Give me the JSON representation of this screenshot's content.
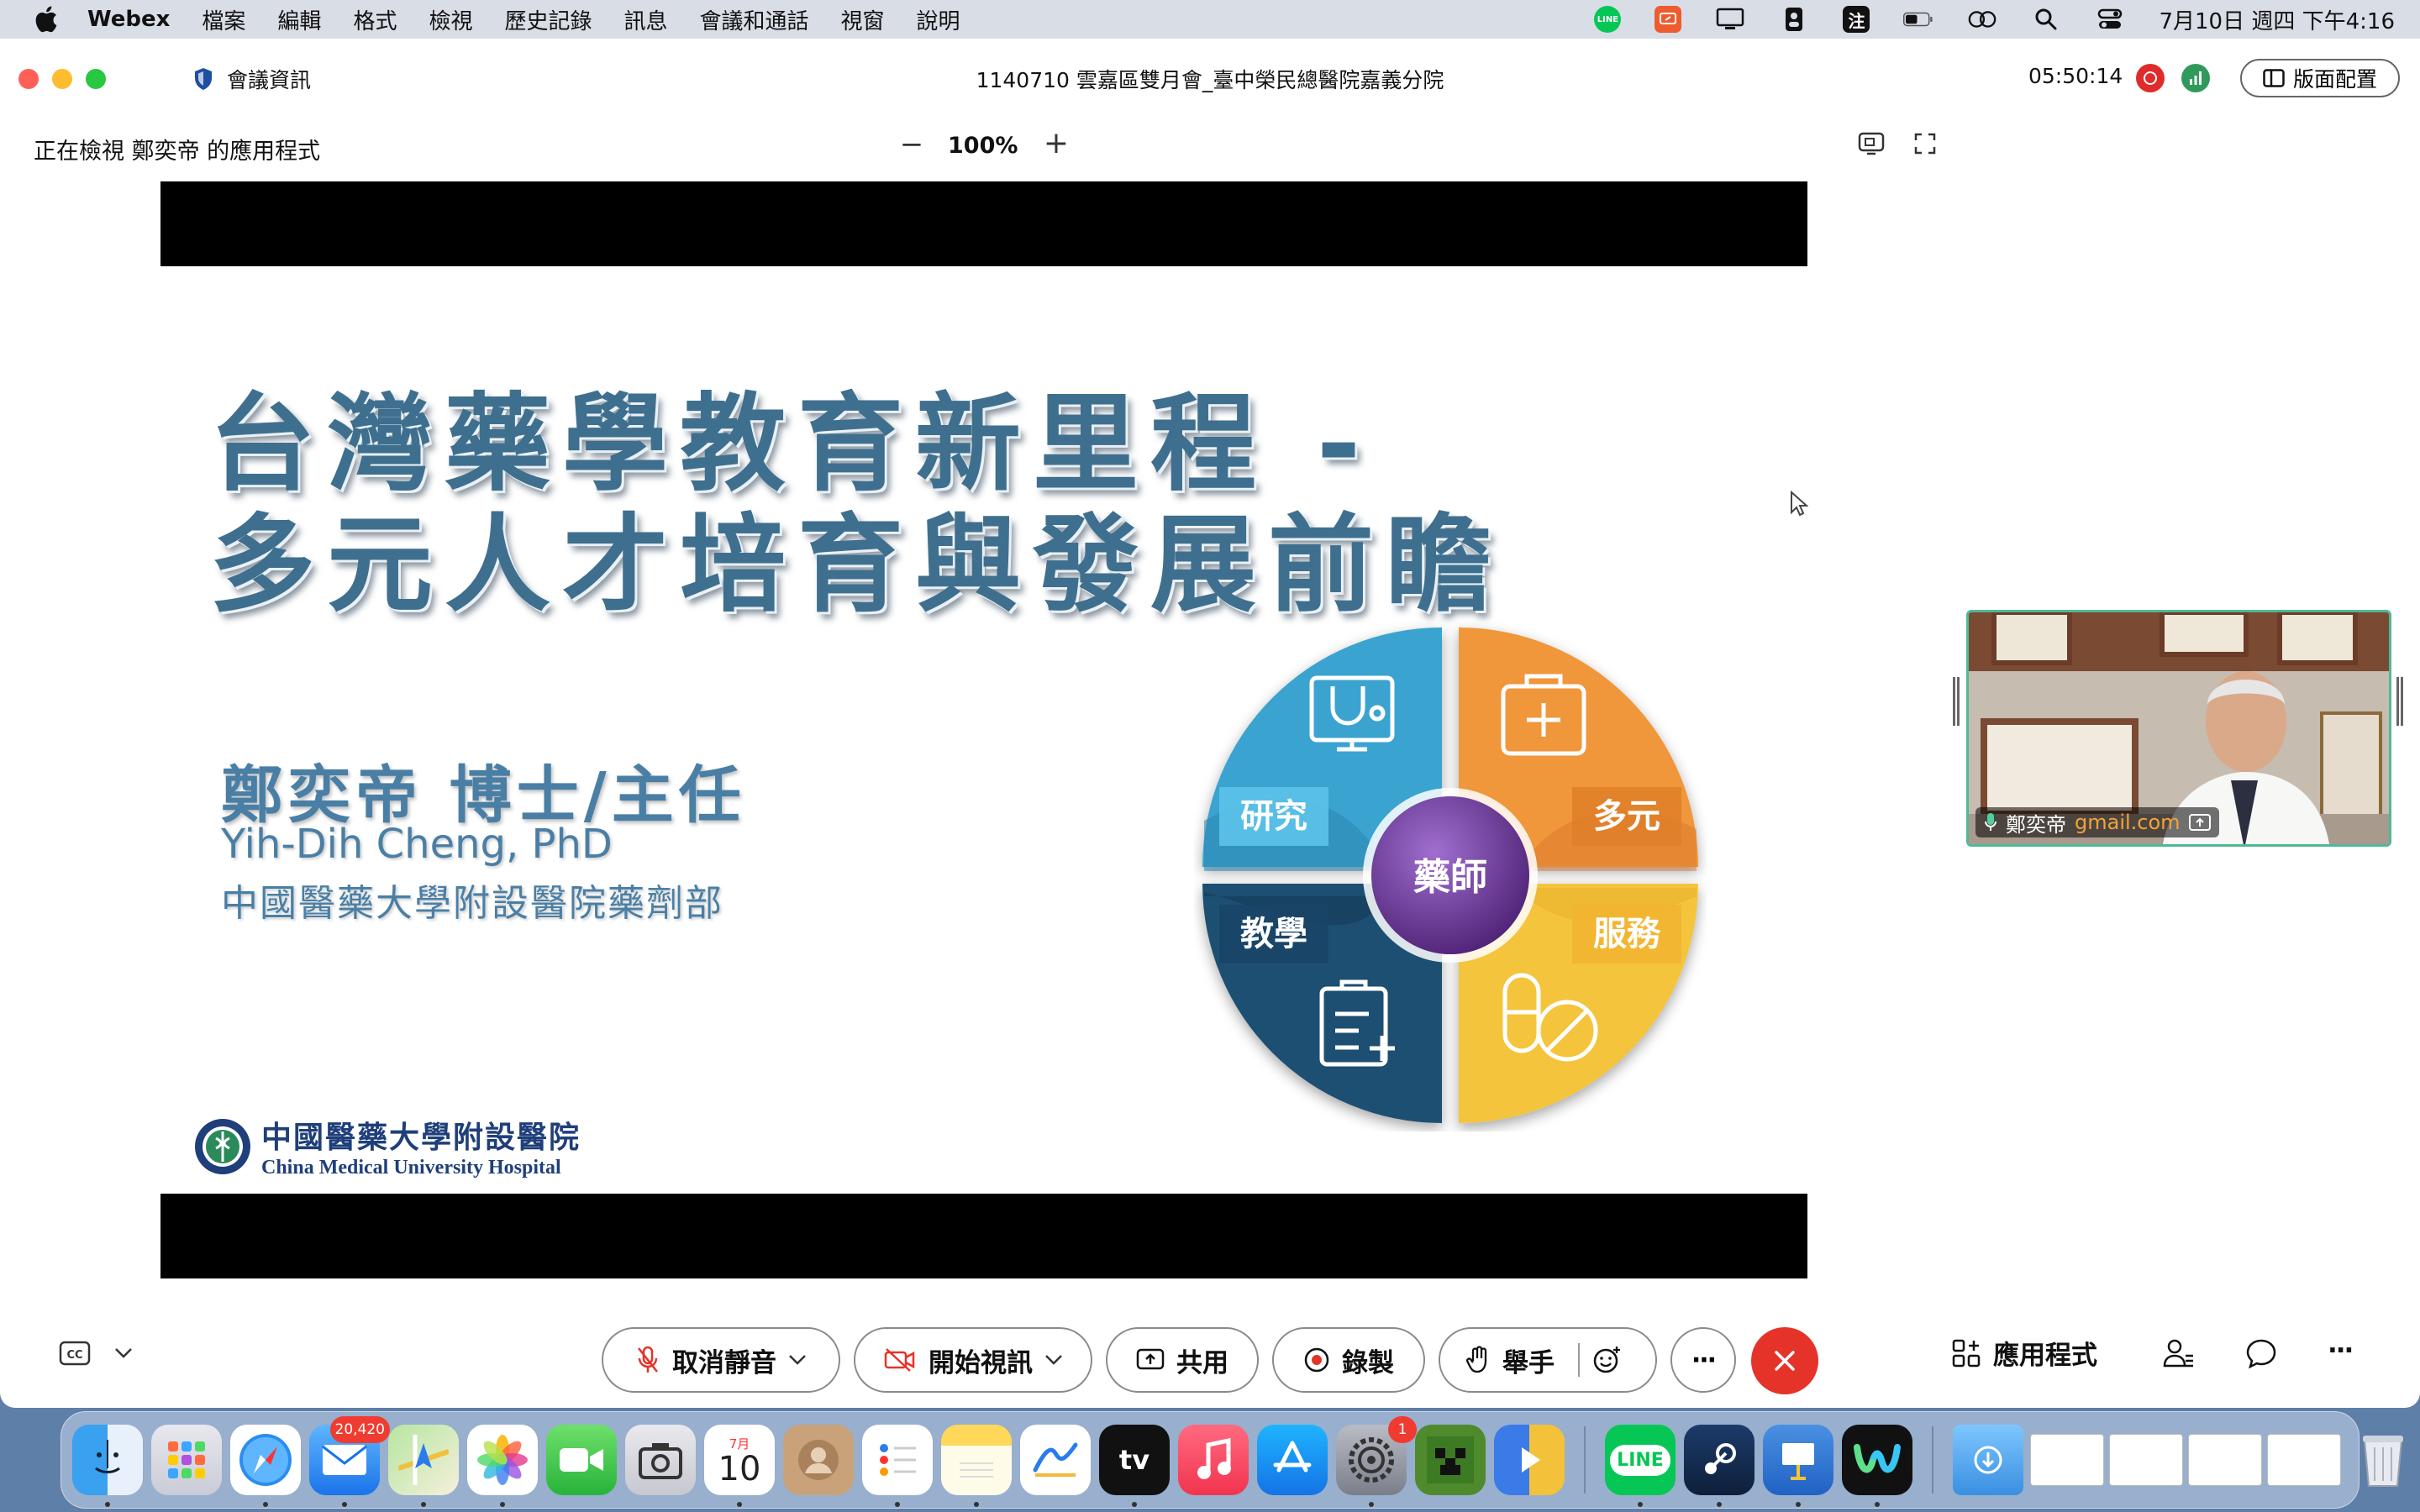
{
  "menubar": {
    "app_name": "Webex",
    "menus": [
      "檔案",
      "編輯",
      "格式",
      "檢視",
      "歷史記錄",
      "訊息",
      "會議和通話",
      "視窗",
      "說明"
    ],
    "status": {
      "line_label": "LINE",
      "input_method_label": "注",
      "datetime": "7月10日 週四 下午4:16"
    }
  },
  "titlebar": {
    "meeting_info_label": "會議資訊",
    "meeting_title": "1140710 雲嘉區雙月會_臺中榮民總醫院嘉義分院",
    "elapsed_time": "05:50:14",
    "layout_label": "版面配置"
  },
  "viewbar": {
    "viewing_label": "正在檢視 鄭奕帝 的應用程式",
    "zoom_minus": "−",
    "zoom_level": "100%",
    "zoom_plus": "+"
  },
  "slide": {
    "title_line1": "台灣藥學教育新里程 -",
    "title_line2": "多元人才培育與發展前瞻",
    "author_cn": "鄭奕帝 博士/主任",
    "author_en": "Yih-Dih Cheng, PhD",
    "author_dept": "中國醫藥大學附設醫院藥劑部",
    "hospital_cn": "中國醫藥大學附設醫院",
    "hospital_en": "China Medical University Hospital",
    "wheel": {
      "center": "藥師",
      "segments": [
        "研究",
        "多元",
        "教學",
        "服務"
      ],
      "colors": {
        "research": "#3aa3cf",
        "diverse": "#f0963a",
        "teaching": "#1f4f72",
        "service": "#f5c43d",
        "center": "#6d3a99"
      }
    }
  },
  "video": {
    "name": "鄭奕帝",
    "email": "gmail.com"
  },
  "controls": {
    "unmute": "取消靜音",
    "start_video": "開始視訊",
    "share": "共用",
    "record": "錄製",
    "raise_hand": "舉手",
    "more": "···",
    "apps": "應用程式",
    "overflow": "···"
  },
  "dock": {
    "mail_badge": "20,420",
    "calendar_month": "7月",
    "calendar_day": "10",
    "settings_badge": "1",
    "tv_label": "tv",
    "line_label": "LINE"
  }
}
